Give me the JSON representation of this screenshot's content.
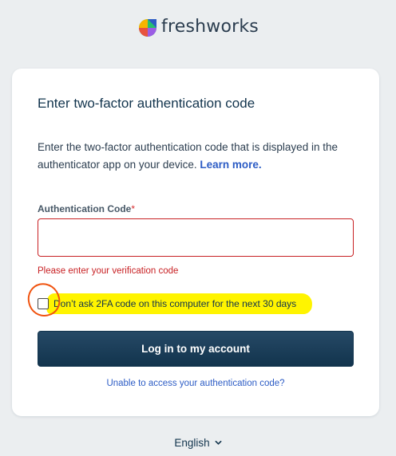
{
  "brand": {
    "name": "freshworks",
    "logo_icon": "freshworks-logo-icon"
  },
  "card": {
    "title": "Enter two-factor authentication code",
    "description": "Enter the two-factor authentication code that is displayed in the authenticator app on your device.",
    "learn_more": "Learn more."
  },
  "form": {
    "code_label": "Authentication Code",
    "required_marker": "*",
    "code_value": "",
    "error_message": "Please enter your verification code",
    "remember_label": "Don’t ask 2FA code on this computer for the next 30 days",
    "remember_checked": false,
    "submit_label": "Log in to my account",
    "help_link": "Unable to access your authentication code?"
  },
  "footer": {
    "language": "English",
    "language_icon": "chevron-down-icon"
  },
  "colors": {
    "background": "#ebeef0",
    "primary_button": "#12344d",
    "link": "#2c5cc5",
    "error": "#c82124",
    "highlight_annotation": "#fff400",
    "circle_annotation": "#f0530f"
  }
}
